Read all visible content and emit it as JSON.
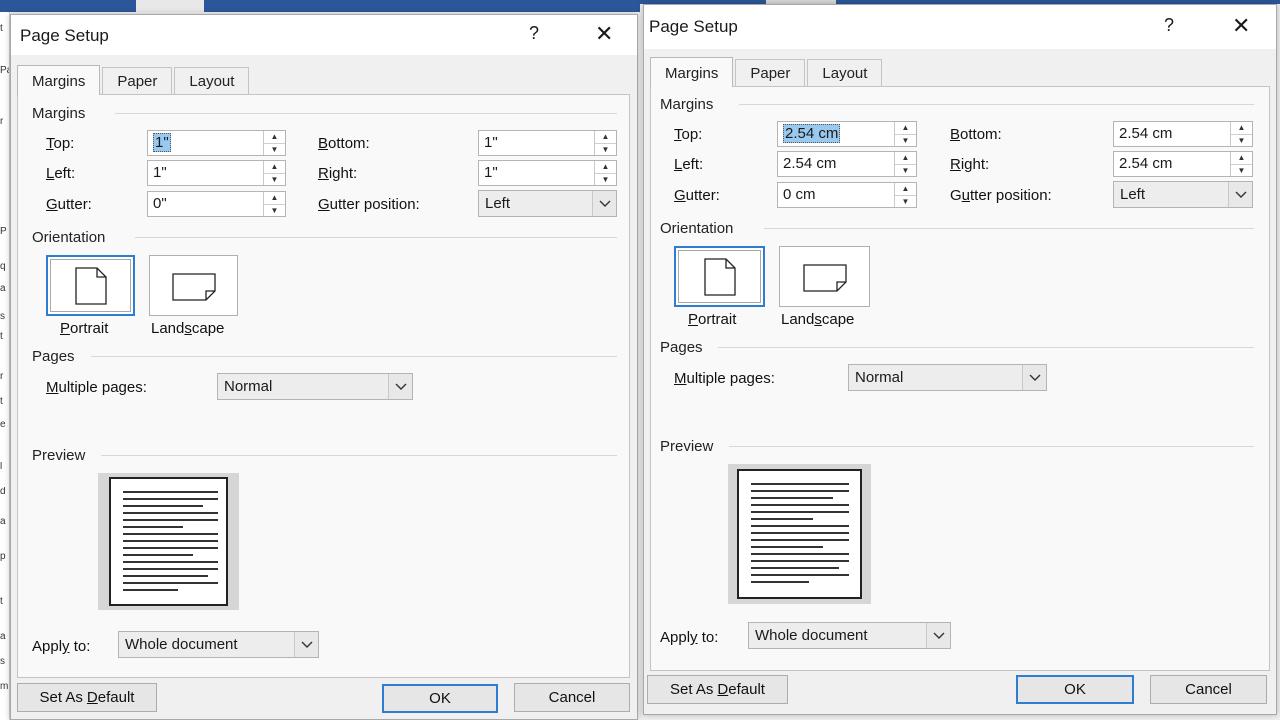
{
  "left_dialog": {
    "title": "Page Setup",
    "help_glyph": "?",
    "close_glyph": "✕",
    "tabs": [
      "Margins",
      "Paper",
      "Layout"
    ],
    "margins_group": "Margins",
    "top_label": "Top:",
    "top_value": "1\"",
    "bottom_label": "Bottom:",
    "bottom_value": "1\"",
    "left_label": "Left:",
    "left_value": "1\"",
    "right_label": "Right:",
    "right_value": "1\"",
    "gutter_label": "Gutter:",
    "gutter_value": "0\"",
    "gutter_pos_label": "Gutter position:",
    "gutter_pos_value": "Left",
    "orientation_group": "Orientation",
    "portrait_label": "Portrait",
    "landscape_label": "Landscape",
    "pages_group": "Pages",
    "multiple_pages_label": "Multiple pages:",
    "multiple_pages_value": "Normal",
    "preview_group": "Preview",
    "apply_to_label": "Apply to:",
    "apply_to_value": "Whole document",
    "set_default_button": "Set As Default",
    "ok_button": "OK",
    "cancel_button": "Cancel"
  },
  "right_dialog": {
    "title": "Page Setup",
    "help_glyph": "?",
    "close_glyph": "✕",
    "tabs": [
      "Margins",
      "Paper",
      "Layout"
    ],
    "margins_group": "Margins",
    "top_label": "Top:",
    "top_value": "2.54 cm",
    "bottom_label": "Bottom:",
    "bottom_value": "2.54 cm",
    "left_label": "Left:",
    "left_value": "2.54 cm",
    "right_label": "Right:",
    "right_value": "2.54 cm",
    "gutter_label": "Gutter:",
    "gutter_value": "0 cm",
    "gutter_pos_label": "Gutter position:",
    "gutter_pos_value": "Left",
    "orientation_group": "Orientation",
    "portrait_label": "Portrait",
    "landscape_label": "Landscape",
    "pages_group": "Pages",
    "multiple_pages_label": "Multiple pages:",
    "multiple_pages_value": "Normal",
    "preview_group": "Preview",
    "apply_to_label": "Apply to:",
    "apply_to_value": "Whole document",
    "set_default_button": "Set As Default",
    "ok_button": "OK",
    "cancel_button": "Cancel"
  },
  "background_left_edge_glyphs": [
    "t",
    "Pape",
    "r",
    "P",
    "q",
    "a",
    "s",
    "t",
    "r",
    "t",
    "e",
    "l",
    "d",
    "a",
    "p",
    "t",
    "a",
    "s",
    "m"
  ],
  "colors": {
    "accent": "#2d7dd2",
    "title_bar_blue": "#2b579a",
    "selection": "#99c9ef"
  }
}
